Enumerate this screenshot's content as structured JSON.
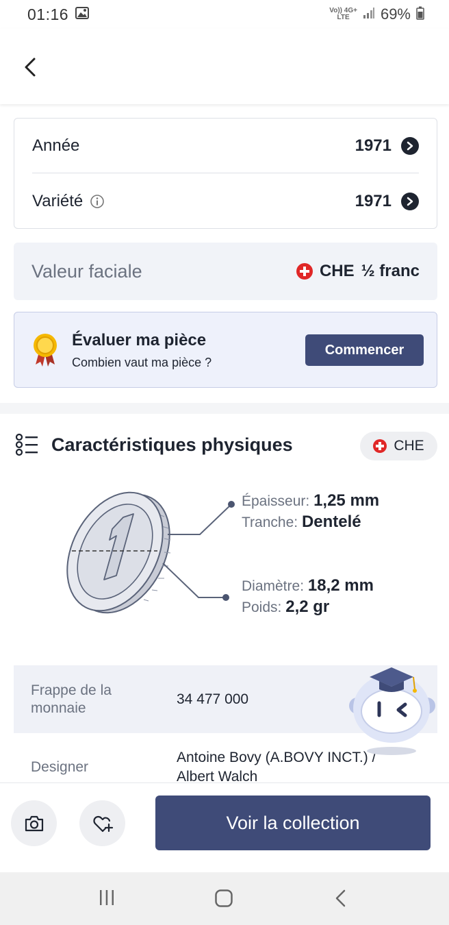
{
  "status_bar": {
    "time": "01:16",
    "network_top": "Vo)) 4G+",
    "network_bottom": "LTE",
    "battery": "69%"
  },
  "header": {
    "back_icon": "chevron-left-icon"
  },
  "selectors": {
    "year_label": "Année",
    "year_value": "1971",
    "variety_label": "Variété",
    "variety_value": "1971"
  },
  "face_value": {
    "label": "Valeur faciale",
    "country": "CHE",
    "value": "½ franc"
  },
  "evaluate": {
    "title": "Évaluer ma pièce",
    "subtitle": "Combien vaut ma pièce ?",
    "button": "Commencer"
  },
  "physical": {
    "title": "Caractéristiques physiques",
    "country": "CHE",
    "thickness_label": "Épaisseur:",
    "thickness_value": "1,25 mm",
    "edge_label": "Tranche:",
    "edge_value": "Dentelé",
    "diameter_label": "Diamètre:",
    "diameter_value": "18,2 mm",
    "weight_label": "Poids:",
    "weight_value": "2,2 gr"
  },
  "details": [
    {
      "key": "Frappe de la monnaie",
      "value": "34 477 000"
    },
    {
      "key": "Designer",
      "value": "Antoine Bovy (A.BOVY INCT.) / Albert Walch"
    }
  ],
  "bottom_bar": {
    "collection_button": "Voir la collection"
  },
  "colors": {
    "primary": "#3f4b78",
    "flag_red": "#e02727",
    "panel_bg": "#f1f3f8"
  }
}
